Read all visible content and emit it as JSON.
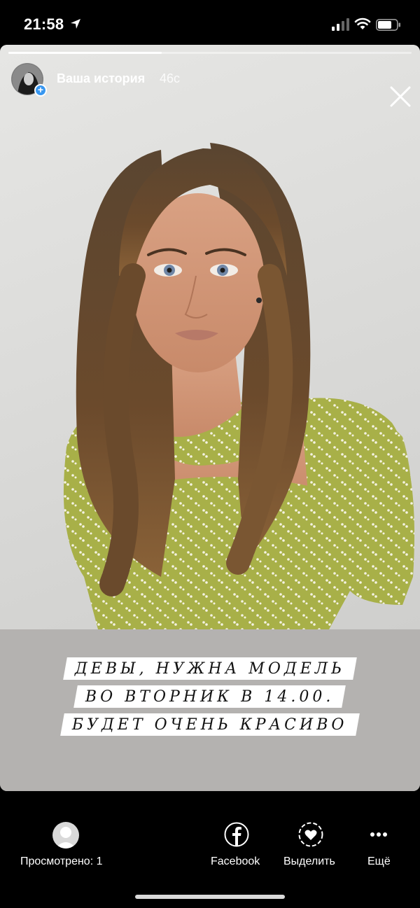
{
  "status_bar": {
    "time": "21:58"
  },
  "story": {
    "progress": 0.38,
    "title": "Ваша история",
    "age": "46с",
    "caption_lines": [
      "ДЕВЫ, НУЖНА МОДЕЛЬ",
      "ВО ВТОРНИК В 14.00.",
      "БУДЕТ ОЧЕНЬ КРАСИВО"
    ]
  },
  "bottom_bar": {
    "viewed_label": "Просмотрено: 1",
    "facebook_label": "Facebook",
    "highlight_label": "Выделить",
    "more_label": "Ещё"
  },
  "colors": {
    "accent": "#3897f0",
    "dress": "#a8b048",
    "hair": "#5a3f28"
  }
}
